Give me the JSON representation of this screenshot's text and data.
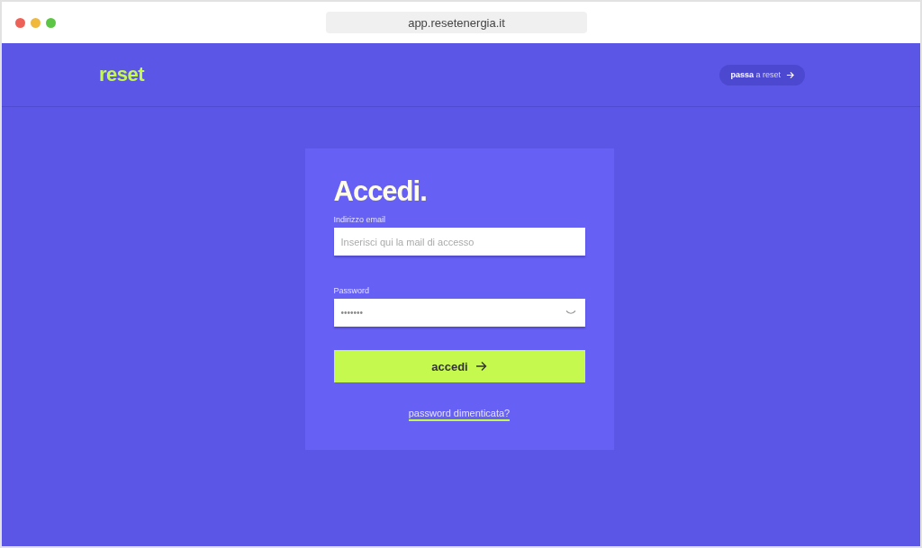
{
  "browser": {
    "url": "app.resetenergia.it"
  },
  "header": {
    "logo": "reset",
    "switch_link": "**passa** a reset"
  },
  "login": {
    "title": "Accedi.",
    "email": {
      "label": "Indirizzo email",
      "placeholder": "Inserisci qui la mail di accesso"
    },
    "password": {
      "label": "Password",
      "value": "•••••••"
    },
    "submit": "accedi",
    "forgot_link": "password dimenticata?"
  }
}
